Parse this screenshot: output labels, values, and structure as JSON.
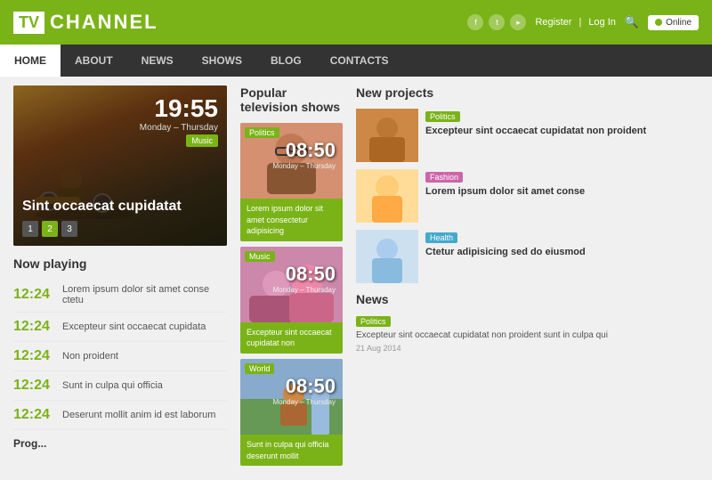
{
  "header": {
    "logo_tv": "TV",
    "logo_channel": "CHANNEL",
    "register": "Register",
    "login": "Log In",
    "online_label": "Online",
    "social": [
      "f",
      "t",
      "rss"
    ]
  },
  "nav": {
    "items": [
      "HOME",
      "ABOUT",
      "NEWS",
      "SHOWS",
      "BLOG",
      "CONTACTS"
    ],
    "active": "HOME"
  },
  "hero": {
    "time": "19:55",
    "time_sub": "Monday – Thursday",
    "badge": "Music",
    "title": "Sint occaecat cupidatat",
    "dots": [
      "1",
      "2",
      "3"
    ]
  },
  "now_playing": {
    "title": "Now playing",
    "items": [
      {
        "time": "12:24",
        "text": "Lorem ipsum dolor sit amet conse ctetu"
      },
      {
        "time": "12:24",
        "text": "Excepteur sint occaecat cupidata"
      },
      {
        "time": "12:24",
        "text": "Non proident"
      },
      {
        "time": "12:24",
        "text": "Sunt in culpa qui officia"
      },
      {
        "time": "12:24",
        "text": "Deserunt mollit anim id est laborum"
      }
    ]
  },
  "popular_tv": {
    "title": "Popular television shows",
    "cards": [
      {
        "category": "Politics",
        "cat_class": "cat-politics",
        "img_class": "card-img-politics",
        "time": "08:50",
        "time_sub": "Monday – Thursday",
        "desc": "Lorem ipsum dolor sit amet consectetur adipisicing"
      },
      {
        "category": "Music",
        "cat_class": "cat-music",
        "img_class": "card-img-music",
        "time": "08:50",
        "time_sub": "Monday – Thursday",
        "desc": "Excepteur sint occaecat cupidatat non"
      },
      {
        "category": "World",
        "cat_class": "cat-world",
        "img_class": "card-img-world",
        "time": "08:50",
        "time_sub": "Monday – Thursday",
        "desc": "Sunt in culpa qui officia deserunt mollit"
      }
    ]
  },
  "new_projects": {
    "title": "New projects",
    "items": [
      {
        "category": "Politics",
        "cat_class": "proj-cat-politics",
        "img_class": "proj-img-1",
        "title": "Excepteur sint occaecat cupidatat non proident"
      },
      {
        "category": "Fashion",
        "cat_class": "proj-cat-fashion",
        "img_class": "proj-img-2",
        "title": "Lorem ipsum dolor sit amet conse"
      },
      {
        "category": "Health",
        "cat_class": "proj-cat-health",
        "img_class": "proj-img-3",
        "title": "Ctetur adipisicing sed do eiusmod"
      }
    ]
  },
  "news": {
    "title": "News",
    "items": [
      {
        "category": "Politics",
        "cat_class": "news-cat-politics",
        "text": "Excepteur sint occaecat cupidatat non proident sunt in culpa qui",
        "date": "21 Aug 2014"
      }
    ]
  }
}
